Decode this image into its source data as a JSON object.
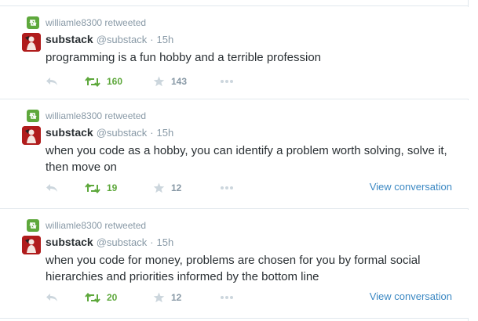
{
  "colors": {
    "retweet_green": "#5ea83c",
    "muted_gray": "#8899a6",
    "link_blue": "#3b88c3",
    "avatar_red": "#b01c1c"
  },
  "icons": {
    "retweet_badge": "retweet-icon",
    "reply": "reply-icon",
    "retweet": "retweet-icon",
    "favorite": "star-icon",
    "more": "ellipsis-icon"
  },
  "tweets": [
    {
      "retweeted_by": "williamle8300 retweeted",
      "fullname": "substack",
      "username": "@substack",
      "separator": "·",
      "time": "15h",
      "text": "programming is a fun hobby and a terrible profession",
      "retweets": "160",
      "favorites": "143",
      "view_conversation": ""
    },
    {
      "retweeted_by": "williamle8300 retweeted",
      "fullname": "substack",
      "username": "@substack",
      "separator": "·",
      "time": "15h",
      "text": "when you code as a hobby, you can identify a problem worth solving, solve it, then move on",
      "retweets": "19",
      "favorites": "12",
      "view_conversation": "View conversation"
    },
    {
      "retweeted_by": "williamle8300 retweeted",
      "fullname": "substack",
      "username": "@substack",
      "separator": "·",
      "time": "15h",
      "text": "when you code for money, problems are chosen for you by formal social hierarchies and priorities informed by the bottom line",
      "retweets": "20",
      "favorites": "12",
      "view_conversation": "View conversation"
    }
  ]
}
